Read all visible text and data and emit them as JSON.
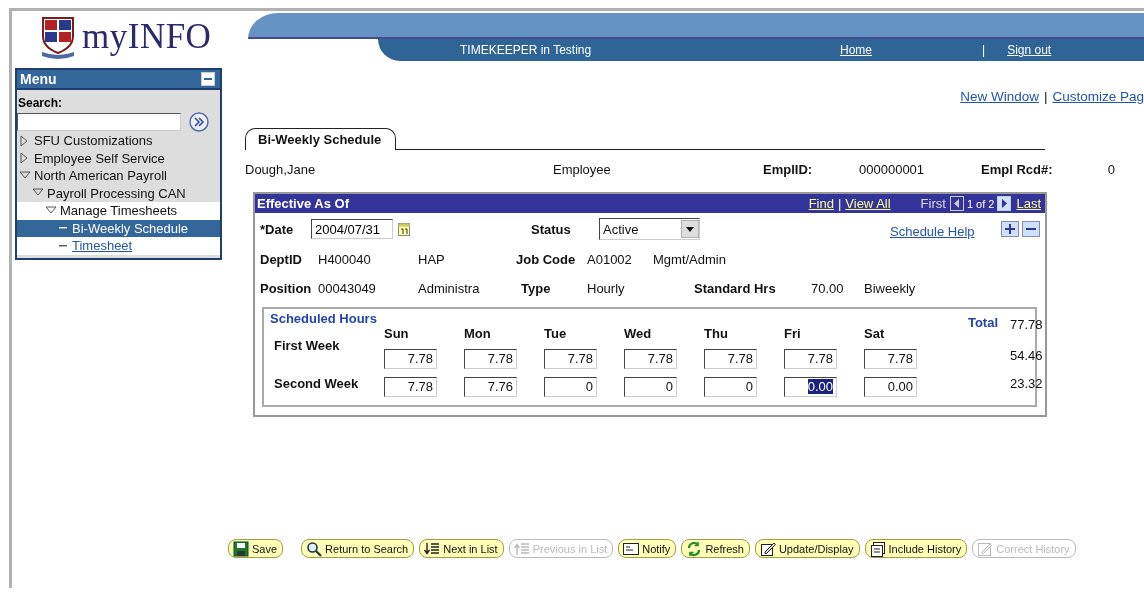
{
  "header": {
    "logo": "myINFO",
    "environment": "TIMEKEEPER in Testing",
    "links": [
      "Home",
      "Sign out"
    ],
    "separator": "|"
  },
  "menu": {
    "title": "Menu",
    "search_label": "Search:",
    "items": [
      {
        "label": "SFU Customizations",
        "kind": "folder",
        "expanded": false,
        "selected": false
      },
      {
        "label": "Employee Self Service",
        "kind": "folder",
        "expanded": false,
        "selected": false
      },
      {
        "label": "North American Payroll",
        "kind": "folder",
        "expanded": true,
        "selected": false,
        "children": [
          {
            "label": "Payroll Processing CAN",
            "kind": "folder",
            "expanded": true,
            "selected": false,
            "children": [
              {
                "label": "Manage Timesheets",
                "kind": "folder",
                "expanded": true,
                "selected": false,
                "children": [
                  {
                    "label": "Bi-Weekly Schedule",
                    "kind": "page",
                    "selected": true
                  },
                  {
                    "label": "Timesheet",
                    "kind": "page",
                    "selected": false
                  }
                ]
              }
            ]
          }
        ]
      }
    ]
  },
  "page_links": [
    "New Window",
    "Customize Pag"
  ],
  "page_links_separator": "|",
  "tabs": [
    {
      "label": "Bi-Weekly Schedule",
      "selected": true
    }
  ],
  "employee": [
    {
      "kind": "value",
      "text": "Dough,Jane"
    },
    {
      "kind": "value",
      "text": "Employee"
    },
    {
      "kind": "label",
      "text": "EmplID:"
    },
    {
      "kind": "value",
      "text": "000000001"
    },
    {
      "kind": "label",
      "text": "Empl Rcd#:"
    },
    {
      "kind": "value",
      "text": "0"
    }
  ],
  "section": {
    "title": "Effective As Of",
    "find": "Find",
    "separator": "|",
    "view_all": "View All",
    "first": "First",
    "count": "1 of 2",
    "last": "Last",
    "date_label": "*Date",
    "date": "2004/07/31",
    "status_label": "Status",
    "status": "Active",
    "help": "Schedule Help",
    "details": [
      [
        {
          "kind": "label",
          "text": "DeptID"
        },
        {
          "kind": "value",
          "text": "H400040"
        },
        {
          "kind": "value",
          "text": "HAP"
        },
        {
          "kind": "label",
          "text": "Job Code"
        },
        {
          "kind": "value",
          "text": "A01002"
        },
        {
          "kind": "value",
          "text": "Mgmt/Admin"
        }
      ],
      [
        {
          "kind": "label",
          "text": "Position"
        },
        {
          "kind": "value",
          "text": "00043049"
        },
        {
          "kind": "value",
          "text": "Administra"
        },
        {
          "kind": "label",
          "text": "Type"
        },
        {
          "kind": "value",
          "text": "Hourly"
        },
        {
          "kind": "label",
          "text": "Standard Hrs"
        },
        {
          "kind": "value",
          "text": "70.00"
        },
        {
          "kind": "value",
          "text": "Biweekly"
        }
      ]
    ]
  },
  "schedule": {
    "title": "Scheduled Hours",
    "total_label": "Total",
    "total": "77.78",
    "days": [
      "Sun",
      "Mon",
      "Tue",
      "Wed",
      "Thu",
      "Fri",
      "Sat"
    ],
    "weeks": [
      {
        "label": "First Week",
        "total": "54.46",
        "hours": [
          {
            "value": "7.78",
            "selected": false
          },
          {
            "value": "7.78",
            "selected": false
          },
          {
            "value": "7.78",
            "selected": false
          },
          {
            "value": "7.78",
            "selected": false
          },
          {
            "value": "7.78",
            "selected": false
          },
          {
            "value": "7.78",
            "selected": false
          },
          {
            "value": "7.78",
            "selected": false
          }
        ]
      },
      {
        "label": "Second Week",
        "total": "23.32",
        "hours": [
          {
            "value": "7.78",
            "selected": false
          },
          {
            "value": "7.76",
            "selected": false
          },
          {
            "value": "0",
            "selected": false
          },
          {
            "value": "0",
            "selected": false
          },
          {
            "value": "0",
            "selected": false
          },
          {
            "value": "0.00",
            "selected": true
          },
          {
            "value": "0.00",
            "selected": false
          }
        ]
      }
    ]
  },
  "buttons": [
    {
      "label": "Save",
      "kind": "save",
      "disabled": false
    },
    {
      "label": "Return to Search",
      "kind": "search",
      "disabled": false
    },
    {
      "label": "Next in List",
      "kind": "next",
      "disabled": false
    },
    {
      "label": "Previous in List",
      "kind": "previous",
      "disabled": true
    },
    {
      "label": "Notify",
      "kind": "notify",
      "disabled": false
    },
    {
      "label": "Refresh",
      "kind": "refresh",
      "disabled": false
    },
    {
      "label": "Update/Display",
      "kind": "edit",
      "disabled": false
    },
    {
      "label": "Include History",
      "kind": "history",
      "disabled": false
    },
    {
      "label": "Correct History",
      "kind": "correct",
      "disabled": true
    }
  ]
}
